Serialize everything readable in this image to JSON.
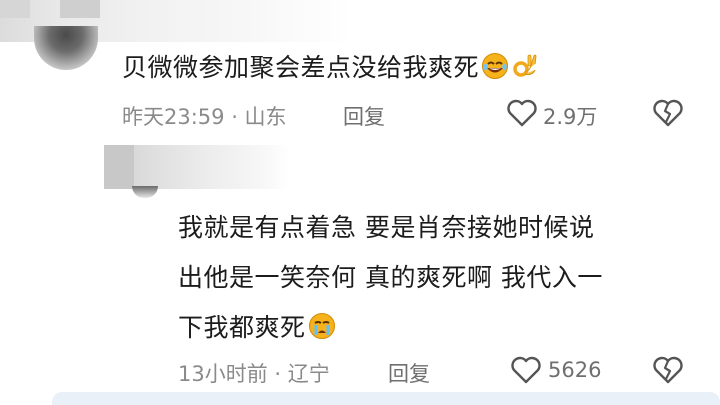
{
  "comments": [
    {
      "text": "贝微微参加聚会差点没给我爽死",
      "emojis": [
        "rolling-laugh-emoji",
        "ok-hand-emoji"
      ],
      "meta": "昨天23:59 · 山东",
      "reply_label": "回复",
      "likes": "2.9万"
    },
    {
      "text_lines": [
        "我就是有点着急 要是肖奈接她时候说",
        "出他是一笑奈何 真的爽死啊 我代入一",
        "下我都爽死"
      ],
      "emojis": [
        "crying-emoji"
      ],
      "meta": "13小时前 · 辽宁",
      "reply_label": "回复",
      "likes": "5626"
    }
  ],
  "icons": {
    "like": "heart-outline-icon",
    "dislike": "broken-heart-icon"
  },
  "colors": {
    "text": "#1c1c1c",
    "meta": "#8a8a8a",
    "icon": "#555555"
  }
}
